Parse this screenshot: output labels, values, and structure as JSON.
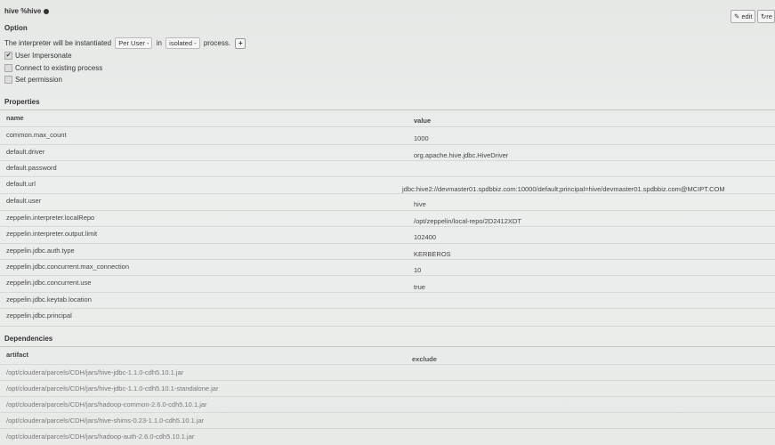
{
  "header": {
    "title": "hive %hive",
    "edit_label": "edit",
    "restart_label": "re"
  },
  "option": {
    "heading": "Option",
    "sentence_prefix": "The interpreter will be instantiated",
    "mode_value": "Per User -",
    "in_word": "in",
    "process_mode_value": "isolated -",
    "process_word": "process.",
    "checkboxes": [
      {
        "label": "User Impersonate",
        "checked": true
      },
      {
        "label": "Connect to existing process",
        "checked": false
      },
      {
        "label": "Set permission",
        "checked": false
      }
    ]
  },
  "properties": {
    "heading": "Properties",
    "col_name": "name",
    "col_value": "value",
    "rows": [
      {
        "name": "common.max_count",
        "value": "1000"
      },
      {
        "name": "default.driver",
        "value": "org.apache.hive.jdbc.HiveDriver"
      },
      {
        "name": "default.password",
        "value": ""
      },
      {
        "name": "default.url",
        "value": "jdbc:hive2://devmaster01.spdbbiz.com:10000/default;principal=hive/devmaster01.spdbbiz.com@MCIPT.COM"
      },
      {
        "name": "default.user",
        "value": "hive"
      },
      {
        "name": "zeppelin.interpreter.localRepo",
        "value": "/opt/zeppelin/local-repo/2D2412XDT"
      },
      {
        "name": "zeppelin.interpreter.output.limit",
        "value": "102400"
      },
      {
        "name": "zeppelin.jdbc.auth.type",
        "value": "KERBEROS"
      },
      {
        "name": "zeppelin.jdbc.concurrent.max_connection",
        "value": "10"
      },
      {
        "name": "zeppelin.jdbc.concurrent.use",
        "value": "true"
      },
      {
        "name": "zeppelin.jdbc.keytab.location",
        "value": ""
      },
      {
        "name": "zeppelin.jdbc.principal",
        "value": ""
      }
    ]
  },
  "dependencies": {
    "heading": "Dependencies",
    "col_artifact": "artifact",
    "col_exclude": "exclude",
    "rows": [
      "/opt/cloudera/parcels/CDH/jars/hive-jdbc-1.1.0-cdh5.10.1.jar",
      "/opt/cloudera/parcels/CDH/jars/hive-jdbc-1.1.0-cdh5.10.1-standalone.jar",
      "/opt/cloudera/parcels/CDH/jars/hadoop-common-2.6.0-cdh5.10.1.jar",
      "/opt/cloudera/parcels/CDH/jars/hive-shims-0.23-1.1.0-cdh5.10.1.jar",
      "/opt/cloudera/parcels/CDH/jars/hadoop-auth-2.6.0-cdh5.10.1.jar"
    ]
  },
  "icons": {
    "edit": "pencil-icon",
    "restart": "refresh-icon",
    "checked": "check-icon",
    "status": "status-dot-icon"
  },
  "colors": {
    "background": "#e8eae8",
    "row_line": "#d8d8d8"
  }
}
